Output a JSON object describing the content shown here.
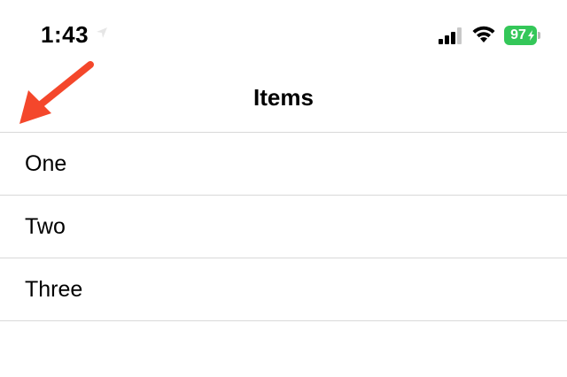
{
  "status_bar": {
    "time": "1:43",
    "battery_level": "97",
    "battery_color": "#34c759",
    "icons": [
      "location-arrow-icon",
      "cellular-signal-icon",
      "wifi-icon",
      "battery-charging-icon"
    ]
  },
  "nav": {
    "title": "Items"
  },
  "list": {
    "items": [
      {
        "label": "One"
      },
      {
        "label": "Two"
      },
      {
        "label": "Three"
      }
    ]
  },
  "annotation": {
    "arrow_color": "#f4472b"
  }
}
